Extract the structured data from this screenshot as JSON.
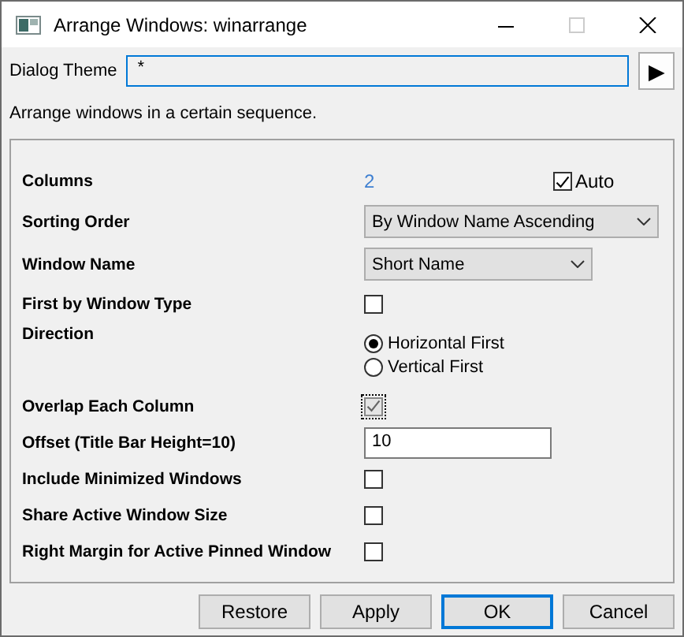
{
  "window": {
    "title": "Arrange Windows: winarrange"
  },
  "dialog_theme": {
    "label": "Dialog Theme",
    "value": "*",
    "button": "▶"
  },
  "description": "Arrange windows in a certain sequence.",
  "rows": [
    {
      "kind": "value",
      "label": "Columns",
      "value": "2",
      "auto": {
        "label": "Auto",
        "checked": true
      }
    },
    {
      "kind": "dropdown",
      "label": "Sorting Order",
      "value": "By Window Name Ascending",
      "wide": true
    },
    {
      "kind": "dropdown",
      "label": "Window Name",
      "value": "Short Name",
      "wide": false
    },
    {
      "kind": "checkbox",
      "label": "First by Window Type",
      "checked": false,
      "disabled": false
    },
    {
      "kind": "radio",
      "label": "Direction",
      "options": [
        {
          "label": "Horizontal First",
          "selected": true
        },
        {
          "label": "Vertical First",
          "selected": false
        }
      ]
    },
    {
      "kind": "checkbox",
      "label": "Overlap Each Column",
      "checked": true,
      "disabled": true
    },
    {
      "kind": "input",
      "label": "Offset (Title Bar Height=10)",
      "value": "10"
    },
    {
      "kind": "checkbox",
      "label": "Include Minimized Windows",
      "checked": false,
      "disabled": false
    },
    {
      "kind": "checkbox",
      "label": "Share Active Window Size",
      "checked": false,
      "disabled": false
    },
    {
      "kind": "checkbox",
      "label": "Right Margin for Active Pinned Window",
      "checked": false,
      "disabled": false
    }
  ],
  "buttons": [
    {
      "label": "Restore",
      "default": false
    },
    {
      "label": "Apply",
      "default": false
    },
    {
      "label": "OK",
      "default": true
    },
    {
      "label": "Cancel",
      "default": false
    }
  ]
}
